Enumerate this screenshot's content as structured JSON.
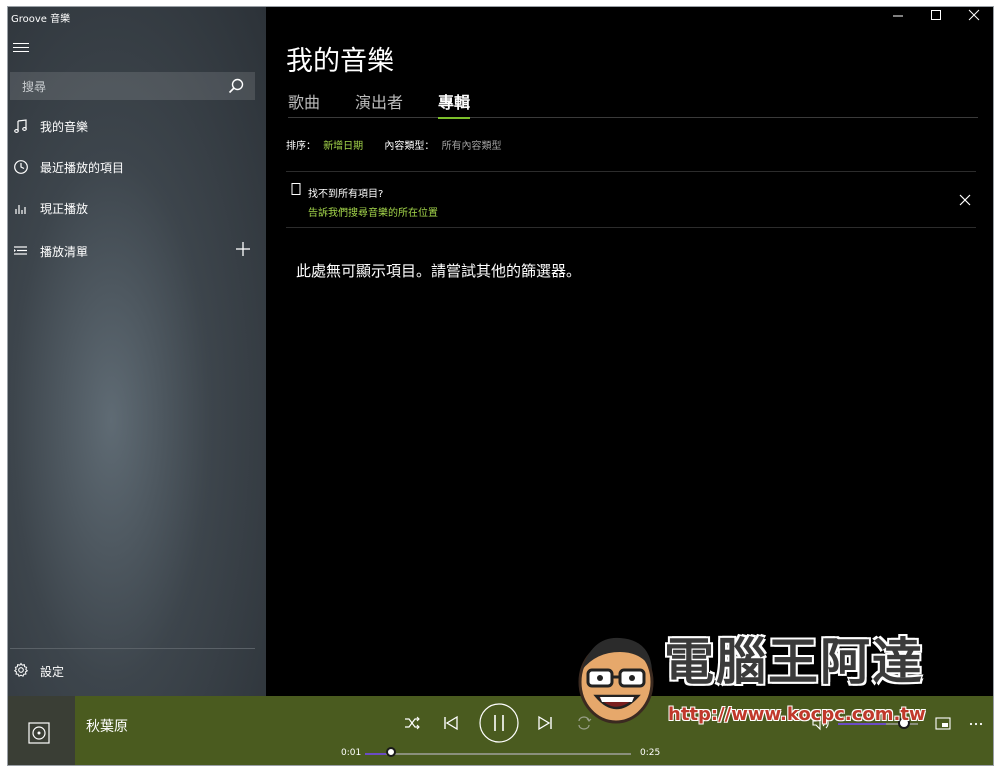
{
  "app": {
    "title": "Groove 音樂"
  },
  "sidebar": {
    "search_placeholder": "搜尋",
    "items": [
      {
        "label": "我的音樂",
        "icon": "music-note-icon"
      },
      {
        "label": "最近播放的項目",
        "icon": "clock-icon"
      },
      {
        "label": "現正播放",
        "icon": "equalizer-icon"
      },
      {
        "label": "播放清單",
        "icon": "playlist-icon"
      }
    ],
    "settings_label": "設定"
  },
  "main": {
    "title": "我的音樂",
    "tabs": [
      {
        "label": "歌曲",
        "active": false
      },
      {
        "label": "演出者",
        "active": false
      },
      {
        "label": "專輯",
        "active": true
      }
    ],
    "sort": {
      "label": "排序：",
      "value": "新增日期",
      "type_label": "內容類型：",
      "type_value": "所有內容類型"
    },
    "notice": {
      "title": "找不到所有項目?",
      "link": "告訴我們搜尋音樂的所在位置"
    },
    "empty_message": "此處無可顯示項目。請嘗試其他的篩選器。"
  },
  "player": {
    "track": "秋葉原",
    "elapsed": "0:01",
    "duration": "0:25",
    "progress": 0.04,
    "volume": 0.6,
    "state": "playing"
  },
  "watermark": {
    "text": "電腦王阿達",
    "url": "http://www.kocpc.com.tw"
  },
  "colors": {
    "accent": "#7bbf2a",
    "link": "#a4d64b",
    "player_bg": "#4a5b1f",
    "sidebar_bg": "#3d454c"
  }
}
